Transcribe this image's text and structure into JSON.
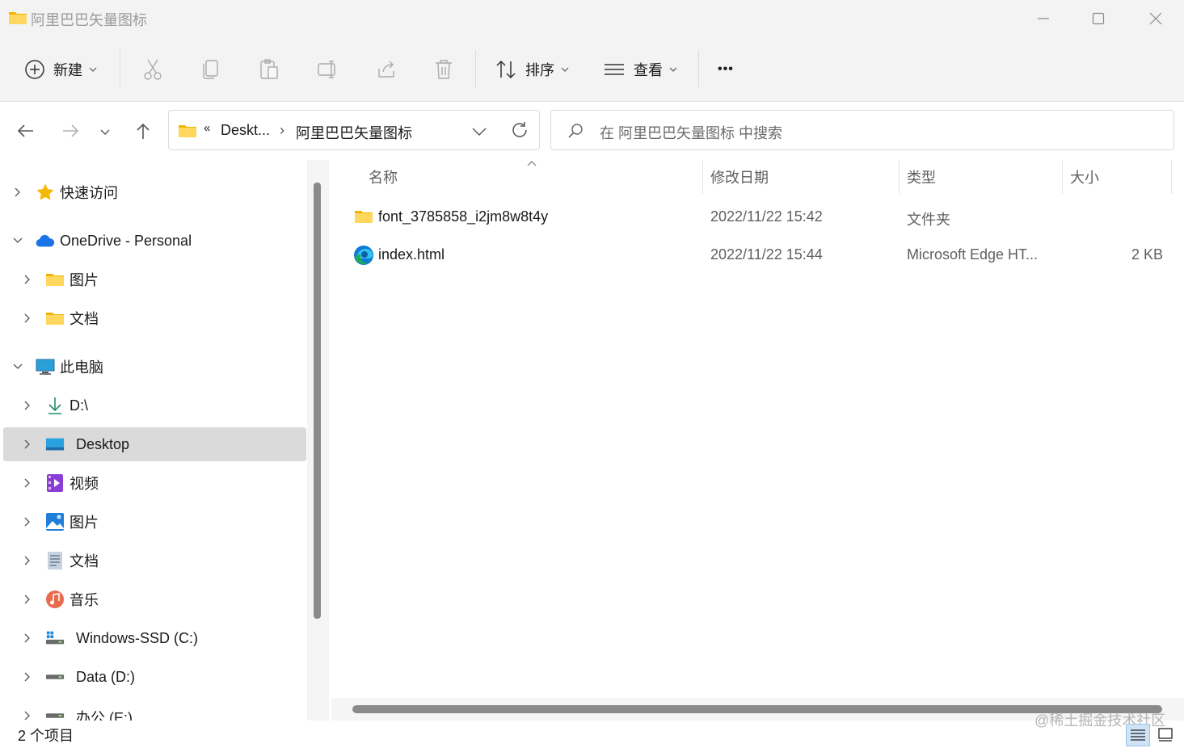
{
  "window": {
    "title": "阿里巴巴矢量图标"
  },
  "toolbar": {
    "new_label": "新建",
    "sort_label": "排序",
    "view_label": "查看",
    "more_label": "•••"
  },
  "address": {
    "overflow": "«",
    "crumbs": [
      "Deskt...",
      "阿里巴巴矢量图标"
    ],
    "separator": "›"
  },
  "search": {
    "placeholder": "在 阿里巴巴矢量图标 中搜索"
  },
  "sidebar": {
    "items": [
      {
        "label": "快速访问",
        "icon": "star-icon",
        "expanded": false
      },
      {
        "label": "OneDrive - Personal",
        "icon": "cloud-icon",
        "expanded": true
      },
      {
        "label": "图片",
        "icon": "folder-icon",
        "expanded": false
      },
      {
        "label": "文档",
        "icon": "folder-icon",
        "expanded": false
      },
      {
        "label": "此电脑",
        "icon": "monitor-icon",
        "expanded": true
      },
      {
        "label": "D:\\",
        "icon": "download-icon",
        "expanded": false
      },
      {
        "label": "Desktop",
        "icon": "desktop-icon",
        "expanded": false,
        "selected": true
      },
      {
        "label": "视频",
        "icon": "video-icon",
        "expanded": false
      },
      {
        "label": "图片",
        "icon": "picture-icon",
        "expanded": false
      },
      {
        "label": "文档",
        "icon": "document-icon",
        "expanded": false
      },
      {
        "label": "音乐",
        "icon": "music-icon",
        "expanded": false
      },
      {
        "label": "Windows-SSD (C:)",
        "icon": "windows-drive-icon",
        "expanded": false
      },
      {
        "label": "Data (D:)",
        "icon": "drive-icon",
        "expanded": false
      },
      {
        "label": "办公 (E:)",
        "icon": "drive-icon",
        "expanded": false
      }
    ]
  },
  "file_list": {
    "columns": {
      "name": "名称",
      "modified": "修改日期",
      "type": "类型",
      "size": "大小"
    },
    "rows": [
      {
        "name": "font_3785858_i2jm8w8t4y",
        "modified": "2022/11/22 15:42",
        "type": "文件夹",
        "size": "",
        "icon": "folder-icon"
      },
      {
        "name": "index.html",
        "modified": "2022/11/22 15:44",
        "type": "Microsoft Edge HT...",
        "size": "2 KB",
        "icon": "edge-icon"
      }
    ]
  },
  "status": {
    "item_count": "2 个项目"
  },
  "watermark": "@稀土掘金技术社区",
  "colors": {
    "accent": "#0067c0",
    "folder": "#f7c948",
    "selection": "#dadada"
  }
}
